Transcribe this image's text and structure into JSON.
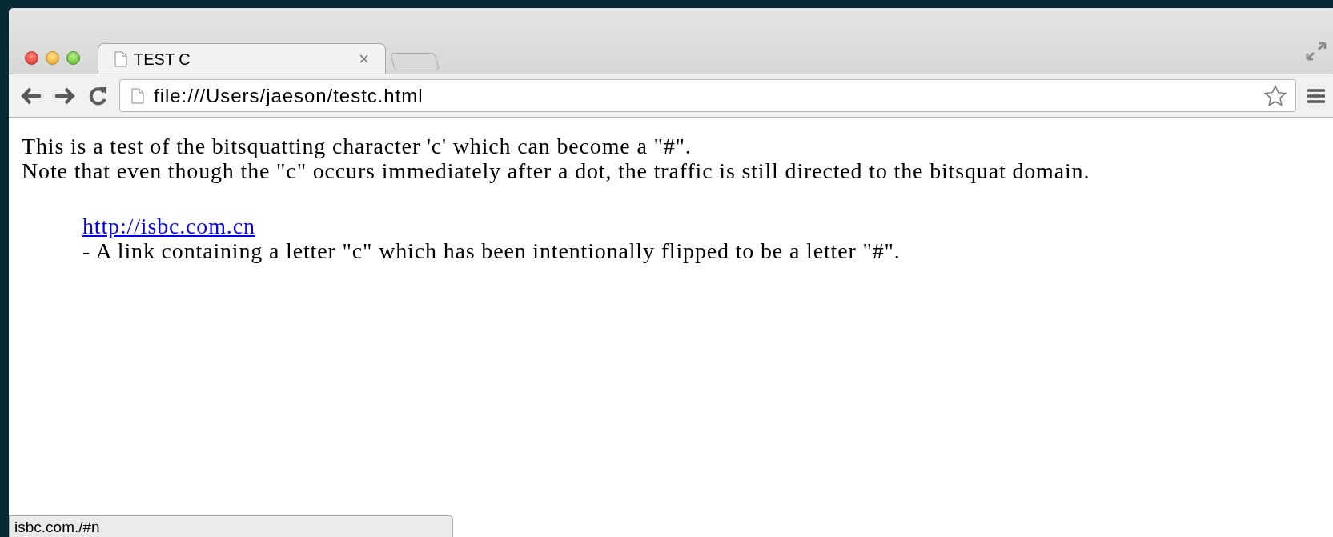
{
  "tabs": [
    {
      "title": "TEST C",
      "selected": true,
      "close": "×"
    }
  ],
  "address_bar": {
    "url": "file:///Users/jaeson/testc.html"
  },
  "page": {
    "paragraphs": [
      "This is a test of the bitsquatting character 'c' which can become a \"#\".",
      "Note that even though the \"c\" occurs immediately after a dot, the traffic is still directed to the bitsquat domain."
    ],
    "link": "http://isbc.com.cn",
    "link_description": "- A link containing a letter \"c\" which has been intentionally flipped to be a letter \"#\"."
  },
  "status_bar": {
    "text": "isbc.com./#n"
  }
}
